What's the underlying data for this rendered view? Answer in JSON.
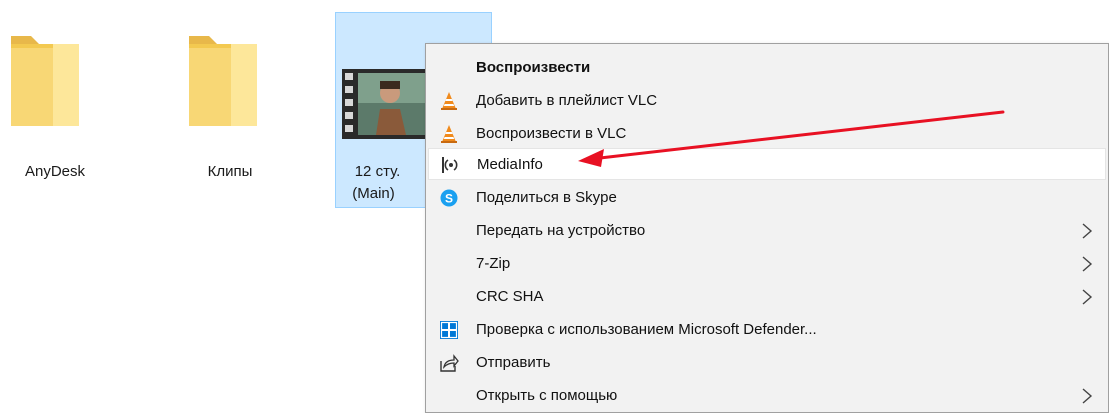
{
  "desktop": {
    "items": [
      {
        "label": "AnyDesk",
        "type": "folder"
      },
      {
        "label": "Клипы",
        "type": "folder"
      },
      {
        "label_line1": "12 сту.",
        "label_line2": "(Main)",
        "type": "video"
      }
    ]
  },
  "context_menu": {
    "items": [
      {
        "label": "Воспроизвести",
        "bold": true,
        "icon": "none"
      },
      {
        "label": "Добавить в плейлист VLC",
        "icon": "vlc-cone-icon"
      },
      {
        "label": "Воспроизвести в VLC",
        "icon": "vlc-cone-icon"
      },
      {
        "label": "MediaInfo",
        "icon": "mediainfo-icon",
        "highlighted": true
      },
      {
        "label": "Поделиться в Skype",
        "icon": "skype-icon"
      },
      {
        "label": "Передать на устройство",
        "icon": "none",
        "submenu": true
      },
      {
        "label": "7-Zip",
        "icon": "none",
        "submenu": true
      },
      {
        "label": "CRC SHA",
        "icon": "none",
        "submenu": true
      },
      {
        "label": "Проверка с использованием Microsoft Defender...",
        "icon": "defender-shield-icon"
      },
      {
        "label": "Отправить",
        "icon": "share-icon"
      },
      {
        "label": "Открыть с помощью",
        "icon": "none",
        "submenu": true
      }
    ]
  },
  "colors": {
    "selection_bg": "#cce8ff",
    "selection_border": "#99d1ff",
    "menu_bg": "#f2f2f2",
    "folder_yellow": "#f8d775",
    "annotation_red": "#e81123",
    "vlc_orange": "#f08a1c",
    "skype_blue": "#1aa0f0",
    "defender_blue": "#0078d7"
  }
}
